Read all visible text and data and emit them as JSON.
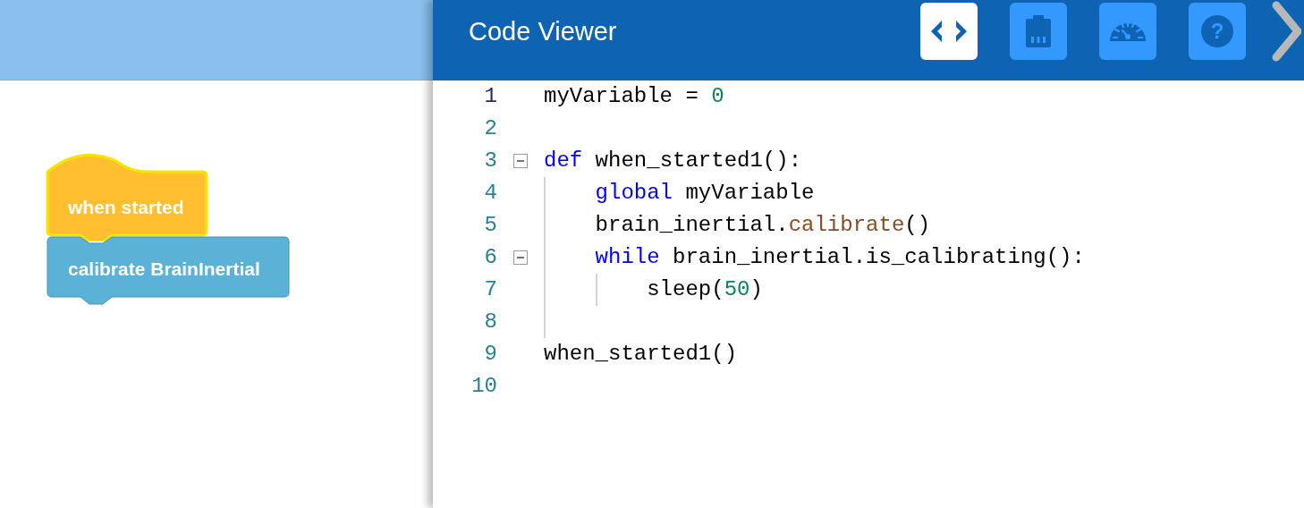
{
  "workspace": {
    "blocks": [
      {
        "kind": "hat",
        "text": "when started",
        "selected": true
      },
      {
        "kind": "command",
        "text": "calibrate BrainInertial",
        "selected": false
      }
    ]
  },
  "code_viewer": {
    "title": "Code Viewer",
    "tabs": [
      {
        "kind": "code",
        "selected": true
      },
      {
        "kind": "device",
        "selected": false
      },
      {
        "kind": "dashboard",
        "selected": false
      },
      {
        "kind": "help",
        "selected": false,
        "label": "?"
      }
    ],
    "lines": [
      {
        "number": "1",
        "current": true,
        "fold": false,
        "tokens": [
          {
            "kind": "plain",
            "text": "myVariable = "
          },
          {
            "kind": "number",
            "text": "0"
          }
        ]
      },
      {
        "number": "2",
        "current": false,
        "fold": false
      },
      {
        "number": "3",
        "current": false,
        "fold": true,
        "tokens": [
          {
            "kind": "keyword",
            "text": "def"
          },
          {
            "kind": "plain",
            "text": " when_started1():"
          }
        ]
      },
      {
        "number": "4",
        "current": false,
        "fold": false,
        "tokens": [
          {
            "kind": "keyword",
            "text": "    global"
          },
          {
            "kind": "plain",
            "text": " myVariable"
          }
        ]
      },
      {
        "number": "5",
        "current": false,
        "fold": false,
        "tokens": [
          {
            "kind": "plain",
            "text": "    brain_inertial."
          },
          {
            "kind": "method",
            "text": "calibrate"
          },
          {
            "kind": "plain",
            "text": "()"
          }
        ]
      },
      {
        "number": "6",
        "current": false,
        "fold": true,
        "tokens": [
          {
            "kind": "keyword",
            "text": "    while"
          },
          {
            "kind": "plain",
            "text": " brain_inertial.is_calibrating():"
          }
        ]
      },
      {
        "number": "7",
        "current": false,
        "fold": false,
        "tokens": [
          {
            "kind": "plain",
            "text": "        sleep("
          },
          {
            "kind": "number",
            "text": "50"
          },
          {
            "kind": "plain",
            "text": ")"
          }
        ]
      },
      {
        "number": "8",
        "current": false,
        "fold": false
      },
      {
        "number": "9",
        "current": false,
        "fold": false,
        "tokens": [
          {
            "kind": "plain",
            "text": "when_started1()"
          }
        ]
      },
      {
        "number": "10",
        "current": false,
        "fold": false
      }
    ]
  }
}
